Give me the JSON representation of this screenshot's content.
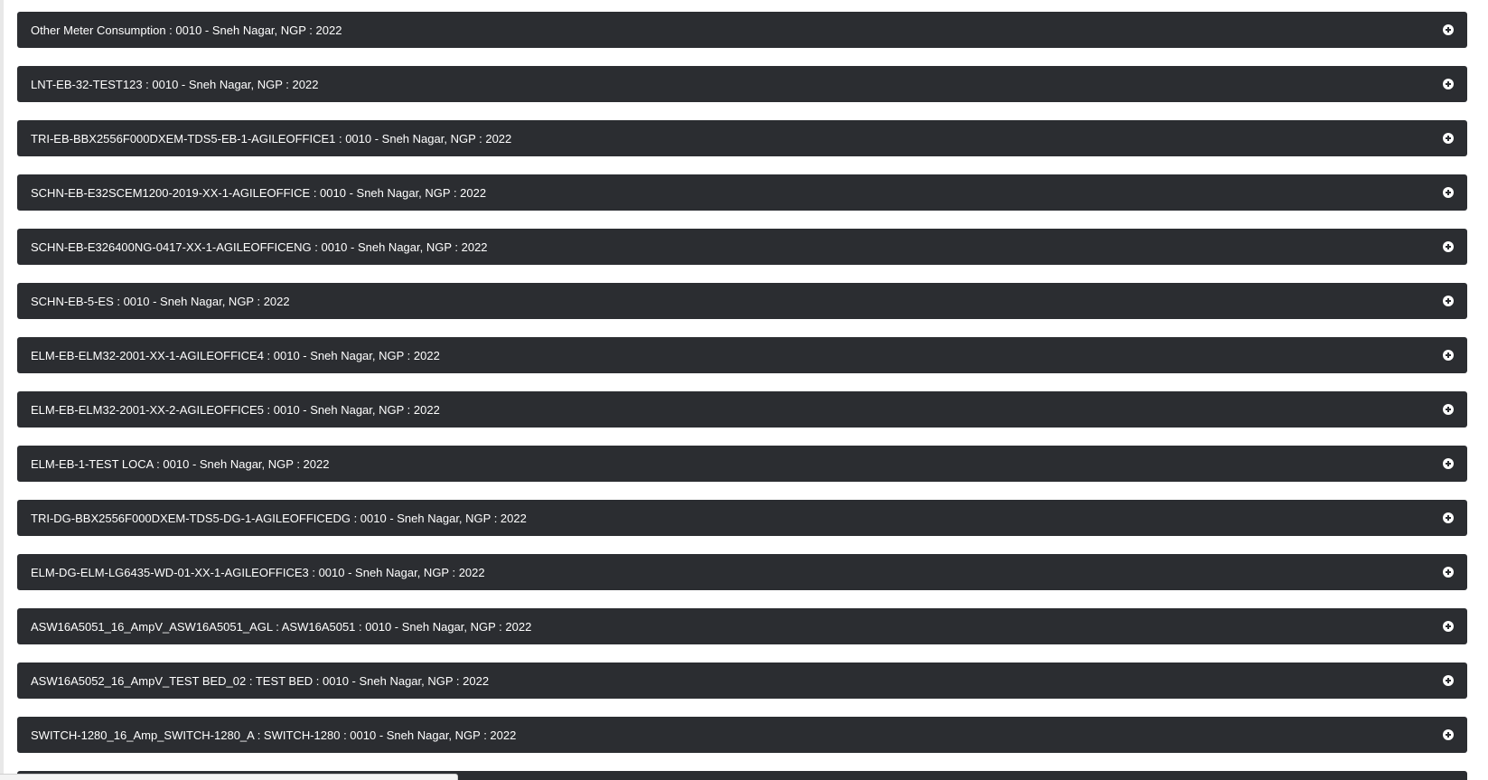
{
  "panels": [
    {
      "title": "Other Meter Consumption : 0010 - Sneh Nagar, NGP : 2022",
      "icon": "plus-circle-icon"
    },
    {
      "title": "LNT-EB-32-TEST123 : 0010 - Sneh Nagar, NGP : 2022",
      "icon": "plus-circle-icon"
    },
    {
      "title": "TRI-EB-BBX2556F000DXEM-TDS5-EB-1-AGILEOFFICE1 : 0010 - Sneh Nagar, NGP : 2022",
      "icon": "plus-circle-icon"
    },
    {
      "title": "SCHN-EB-E32SCEM1200-2019-XX-1-AGILEOFFICE : 0010 - Sneh Nagar, NGP : 2022",
      "icon": "plus-circle-icon"
    },
    {
      "title": "SCHN-EB-E326400NG-0417-XX-1-AGILEOFFICENG : 0010 - Sneh Nagar, NGP : 2022",
      "icon": "plus-circle-icon"
    },
    {
      "title": "SCHN-EB-5-ES : 0010 - Sneh Nagar, NGP : 2022",
      "icon": "plus-circle-icon"
    },
    {
      "title": "ELM-EB-ELM32-2001-XX-1-AGILEOFFICE4 : 0010 - Sneh Nagar, NGP : 2022",
      "icon": "plus-circle-icon"
    },
    {
      "title": "ELM-EB-ELM32-2001-XX-2-AGILEOFFICE5 : 0010 - Sneh Nagar, NGP : 2022",
      "icon": "plus-circle-icon"
    },
    {
      "title": "ELM-EB-1-TEST LOCA : 0010 - Sneh Nagar, NGP : 2022",
      "icon": "plus-circle-icon"
    },
    {
      "title": "TRI-DG-BBX2556F000DXEM-TDS5-DG-1-AGILEOFFICEDG : 0010 - Sneh Nagar, NGP : 2022",
      "icon": "plus-circle-icon"
    },
    {
      "title": "ELM-DG-ELM-LG6435-WD-01-XX-1-AGILEOFFICE3 : 0010 - Sneh Nagar, NGP : 2022",
      "icon": "plus-circle-icon"
    },
    {
      "title": "ASW16A5051_16_AmpV_ASW16A5051_AGL : ASW16A5051 : 0010 - Sneh Nagar, NGP : 2022",
      "icon": "plus-circle-icon"
    },
    {
      "title": "ASW16A5052_16_AmpV_TEST BED_02 : TEST BED : 0010 - Sneh Nagar, NGP : 2022",
      "icon": "plus-circle-icon"
    },
    {
      "title": "SWITCH-1280_16_Amp_SWITCH-1280_A : SWITCH-1280 : 0010 - Sneh Nagar, NGP : 2022",
      "icon": "plus-circle-icon"
    }
  ],
  "colors": {
    "panel_background": "#2b2d31",
    "panel_text": "#ffffff",
    "page_background": "#ffffff"
  }
}
